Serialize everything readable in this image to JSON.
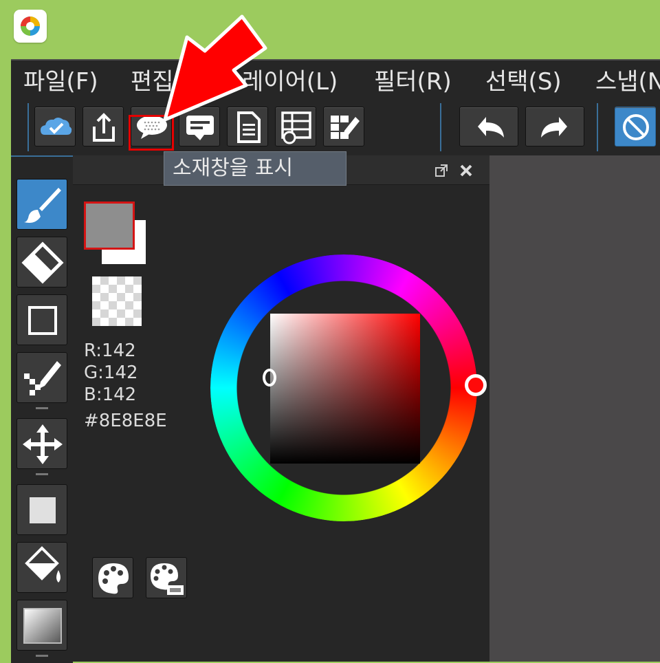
{
  "app": {
    "icon": "medibang-logo-icon"
  },
  "menu": [
    {
      "label": "파일(F)"
    },
    {
      "label": "편집(E)"
    },
    {
      "label": "레이어(L)"
    },
    {
      "label": "필터(R)"
    },
    {
      "label": "선택(S)"
    },
    {
      "label": "스냅(N)"
    }
  ],
  "toolbar": {
    "buttons": [
      {
        "icon": "cloud-check-icon"
      },
      {
        "icon": "share-upload-icon"
      },
      {
        "icon": "speech-bubble-icon"
      },
      {
        "icon": "comment-icon"
      },
      {
        "icon": "document-icon"
      },
      {
        "icon": "table-clock-icon"
      },
      {
        "icon": "grid-edit-icon"
      },
      {
        "icon": "undo-icon"
      },
      {
        "icon": "redo-icon"
      },
      {
        "icon": "no-snap-icon"
      }
    ],
    "tooltip": "소재창을 표시",
    "highlight_color": "#e60000"
  },
  "tools": [
    {
      "icon": "brush-icon",
      "active": true
    },
    {
      "icon": "eraser-icon"
    },
    {
      "icon": "rectangle-select-icon"
    },
    {
      "icon": "pen-dotted-icon"
    },
    {
      "icon": "move-icon"
    },
    {
      "icon": "fill-rect-icon"
    },
    {
      "icon": "bucket-icon"
    },
    {
      "icon": "gradient-icon"
    }
  ],
  "color_panel": {
    "popout_icon": "popout-icon",
    "close_icon": "close-icon",
    "foreground": "#8E8E8E",
    "background": "#FFFFFF",
    "rgb": {
      "r": "R:142",
      "g": "G:142",
      "b": "B:142"
    },
    "hex": "#8E8E8E",
    "palette_buttons": [
      {
        "icon": "palette-icon"
      },
      {
        "icon": "palette-add-icon"
      }
    ]
  },
  "accent": "#3d88c9"
}
